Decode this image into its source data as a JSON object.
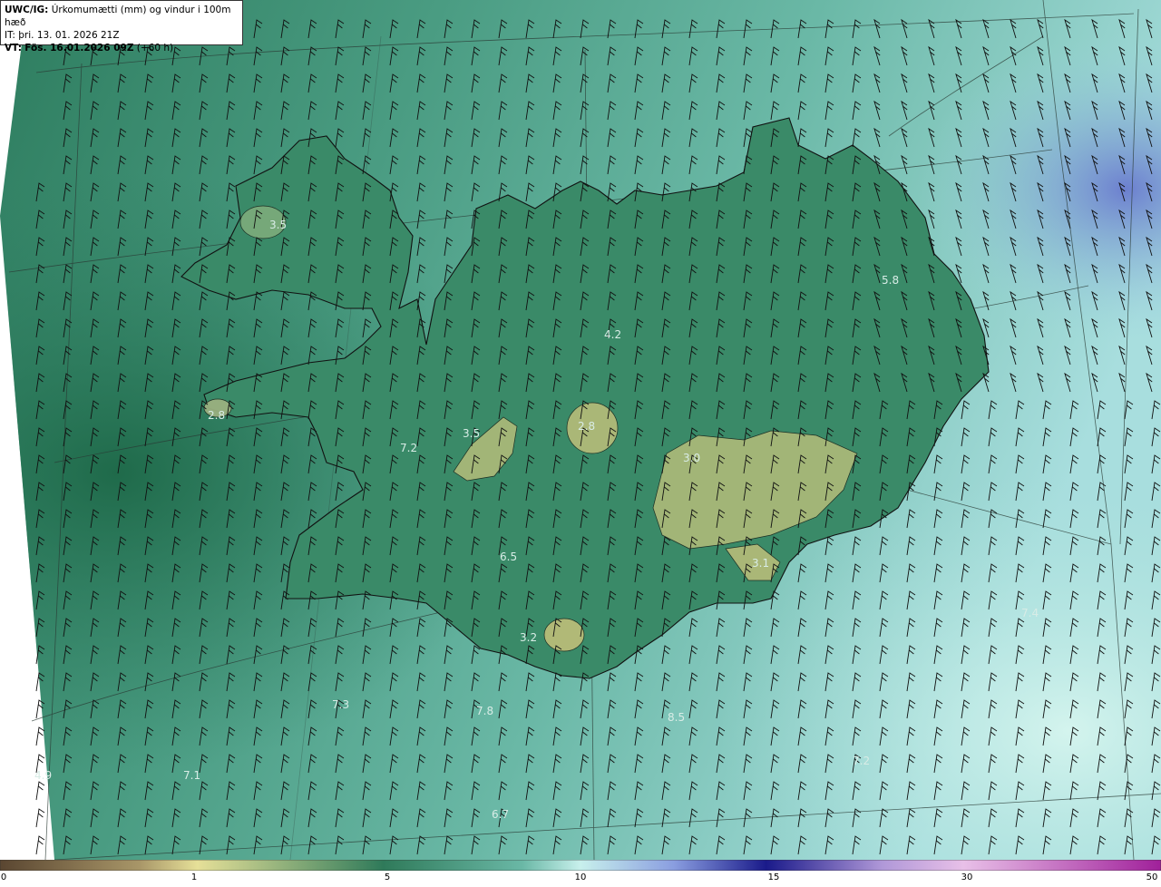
{
  "header": {
    "product_code": "UWC/IG:",
    "product_desc": "Úrkomumætti (mm) og vindur i 100m hæð",
    "it_label": "IT:",
    "it_value": "þri. 13. 01. 2026 21Z",
    "vt_label": "VT:",
    "vt_value": "Fös. 16.01.2026 09Z",
    "vt_lead": "(+60 h)"
  },
  "map_values": [
    "3.5",
    "5.8",
    "4.2",
    "2.8",
    "3.5",
    "2.8",
    "7.2",
    "3.0",
    "6.5",
    "3.1",
    "3.2",
    "7.4",
    "7.3",
    "7.8",
    "8.5",
    "4.9",
    "7.1",
    "7.2",
    "6.7"
  ],
  "colorbar": {
    "ticks": [
      "0",
      "1",
      "5",
      "10",
      "15",
      "30",
      "50"
    ],
    "colors": [
      "#5a4631",
      "#a89668",
      "#e6e098",
      "#2f7a5a",
      "#9ee4dc",
      "#c8f0ec",
      "#1a1a8a",
      "#e8c0e8",
      "#a0209a"
    ]
  }
}
